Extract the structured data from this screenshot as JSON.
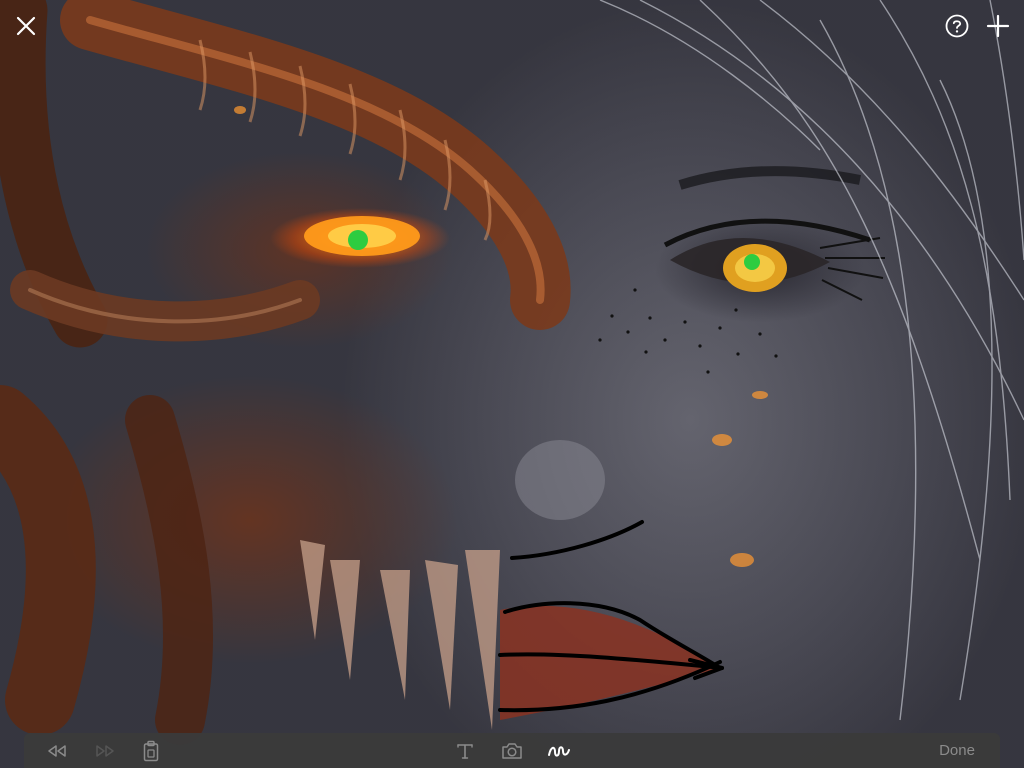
{
  "window": {
    "close_icon": "close-icon",
    "help_icon": "help-circle-icon",
    "add_icon": "plus-icon"
  },
  "canvas": {
    "subject": "drawing-over-photo",
    "ink_color": "#000000",
    "highlight_color": "#2ecc40"
  },
  "toolbar": {
    "rewind_icon": "rewind-icon",
    "forward_icon": "fast-forward-icon",
    "paste_icon": "clipboard-icon",
    "text_icon": "text-tool-icon",
    "camera_icon": "camera-icon",
    "draw_icon": "scribble-icon",
    "done_label": "Done"
  },
  "colors": {
    "toolbar_bg": "#3a3a3a",
    "icon_active": "#ffffff",
    "icon_inactive": "#8b8b8b",
    "icon_disabled": "#555555"
  }
}
